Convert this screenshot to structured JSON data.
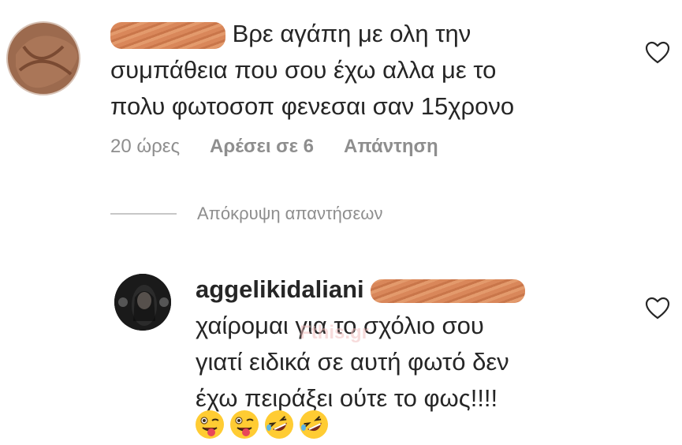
{
  "comment1": {
    "text_lines": [
      "Βρε αγάπη με ολη την",
      "συμπάθεια που σου έχω αλλα με το",
      "πολυ φωτοσοπ φενεσαι σαν 15χρονο"
    ],
    "meta": {
      "time": "20 ώρες",
      "likes": "Αρέσει σε 6",
      "reply": "Απάντηση"
    }
  },
  "hide_replies": "Απόκρυψη απαντήσεων",
  "reply": {
    "username": "aggelikidaliani",
    "text_lines": [
      "χαίρομαι για το σχόλιο σου",
      "γιατί ειδικά σε αυτή φωτό δεν",
      "έχω πειράξει ούτε το φως!!!!"
    ],
    "emojis": [
      "😜",
      "😜",
      "🤣",
      "🤣"
    ]
  },
  "watermark": "Fthis.gr",
  "colors": {
    "text": "#262626",
    "meta": "#8e8e8e",
    "redaction": "#d9875a",
    "emoji": "#ffcc33"
  },
  "icons": [
    "like-heart-icon",
    "like-heart-icon"
  ]
}
